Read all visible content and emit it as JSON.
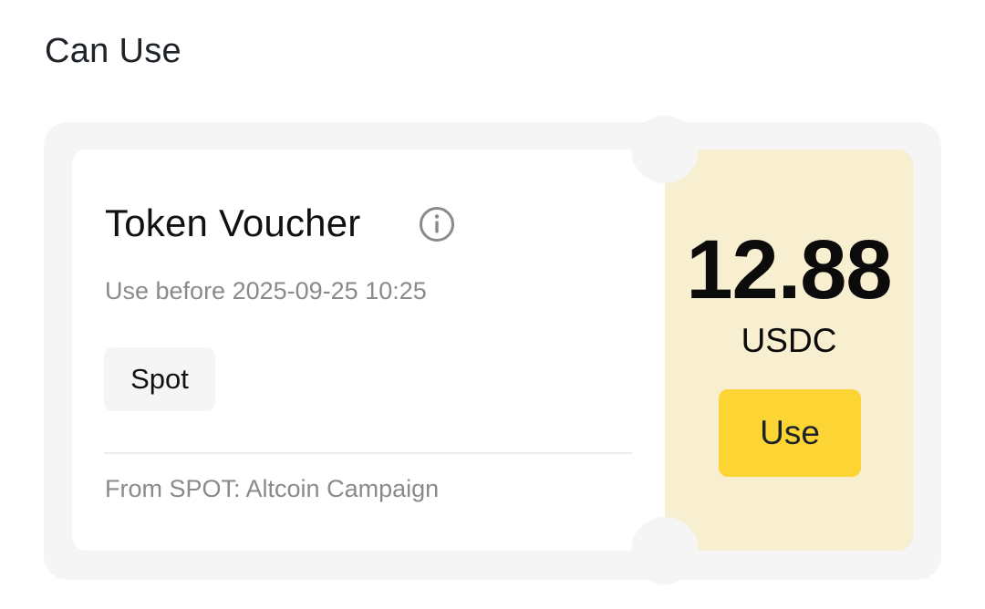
{
  "section": {
    "title": "Can Use"
  },
  "voucher": {
    "title": "Token Voucher",
    "info_icon": "info-circle-icon",
    "expiry": "Use before 2025-09-25 10:25",
    "tag": "Spot",
    "source": "From SPOT: Altcoin Campaign",
    "amount": "12.88",
    "currency": "USDC",
    "use_label": "Use"
  },
  "colors": {
    "accent": "#fcd535",
    "voucher_value_bg": "#f8efd0",
    "card_bg": "#f5f5f5",
    "muted_text": "#8a8a8a"
  }
}
